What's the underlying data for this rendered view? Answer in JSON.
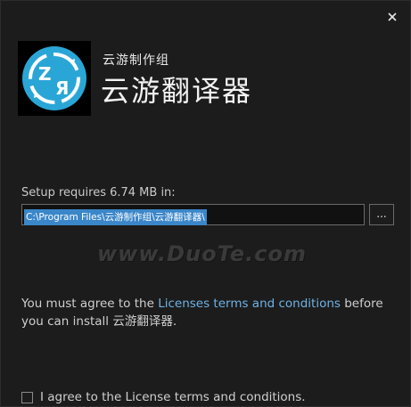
{
  "window": {
    "close_icon": "close-icon"
  },
  "header": {
    "publisher": "云游制作组",
    "app_title": "云游翻译器",
    "logo_icon": "translate-logo-icon",
    "logo_letters": [
      "Z",
      "Я"
    ]
  },
  "install": {
    "requirement_label": "Setup requires 6.74 MB in:",
    "path_value": "C:\\Program Files\\云游制作组\\云游翻译器\\",
    "browse_label": "..."
  },
  "watermark": "www.DuoTe.com",
  "license": {
    "prefix": "You must agree to the ",
    "link_text": "Licenses terms and conditions",
    "suffix": " before you can install 云游翻译器."
  },
  "agreement": {
    "checkbox_checked": false,
    "label": "I agree to the License terms and conditions."
  },
  "colors": {
    "background": "#1c1c1c",
    "accent_link": "#6fb2e6",
    "selection": "#3b86c9",
    "logo_ring": "#2aa6d6"
  }
}
